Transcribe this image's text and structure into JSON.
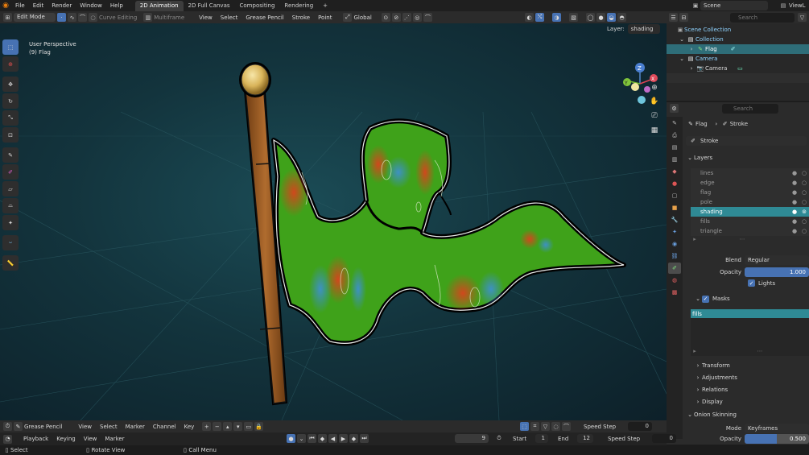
{
  "menu": {
    "items": [
      "File",
      "Edit",
      "Render",
      "Window",
      "Help"
    ],
    "workspaces": [
      {
        "label": "2D Animation",
        "active": true
      },
      {
        "label": "2D Full Canvas",
        "active": false
      },
      {
        "label": "Compositing",
        "active": false
      },
      {
        "label": "Rendering",
        "active": false
      }
    ],
    "add_tab": "+",
    "scene_label": "Scene",
    "view_layer_label": "ViewL"
  },
  "viewport_header": {
    "mode": "Edit Mode",
    "curve_editing": "Curve Editing",
    "multiframe": "Multiframe",
    "menus": [
      "View",
      "Select",
      "Grease Pencil",
      "Stroke",
      "Point"
    ],
    "transform_orientation": "Global",
    "layer_label": "Layer:",
    "layer_value": "shading"
  },
  "viewport": {
    "perspective_label": "User Perspective",
    "object_label": "(9) Flag",
    "gizmo": {
      "z": "Z",
      "x": "X",
      "y": "Y"
    },
    "colors": {
      "bg_center": "#1b4c56",
      "flag_green": "#3fa21a",
      "pole_brown": "#9a5a24",
      "knob_gold": "#d9b45a"
    }
  },
  "toolbar": {
    "tools": [
      "select-box",
      "cursor",
      "move",
      "rotate",
      "scale",
      "transform",
      "draw",
      "tint",
      "shear",
      "to-sphere",
      "radius",
      "interpolate",
      "measure"
    ]
  },
  "outliner": {
    "search_placeholder": "Search",
    "rows": [
      {
        "label": "Scene Collection",
        "indent": 0,
        "selected": false
      },
      {
        "label": "Collection",
        "indent": 1,
        "selected": false
      },
      {
        "label": "Flag",
        "indent": 2,
        "selected": true
      },
      {
        "label": "Camera",
        "indent": 1,
        "selected": false
      },
      {
        "label": "Camera",
        "indent": 2,
        "selected": false
      }
    ]
  },
  "properties": {
    "search_placeholder": "Search",
    "breadcrumb": {
      "object": "Flag",
      "data": "Stroke"
    },
    "data_name": "Stroke",
    "layers_title": "Layers",
    "layers": [
      {
        "name": "lines",
        "selected": false
      },
      {
        "name": "edge",
        "selected": false
      },
      {
        "name": "flag",
        "selected": false
      },
      {
        "name": "pole",
        "selected": false
      },
      {
        "name": "shading",
        "selected": true
      },
      {
        "name": "fills",
        "selected": false
      },
      {
        "name": "triangle",
        "selected": false
      }
    ],
    "blend_label": "Blend",
    "blend_value": "Regular",
    "opacity_label": "Opacity",
    "opacity_value": "1.000",
    "opacity_fraction": 1.0,
    "lights_label": "Lights",
    "masks_title": "Masks",
    "mask_item": "fills",
    "sections": [
      "Transform",
      "Adjustments",
      "Relations",
      "Display"
    ],
    "onion_title": "Onion Skinning",
    "onion_mode_label": "Mode",
    "onion_mode_value": "Keyframes",
    "onion_opacity_label": "Opacity",
    "onion_opacity_value": "0.500",
    "onion_opacity_fraction": 0.5
  },
  "timeline": {
    "editor": "Grease Pencil",
    "menus": [
      "View",
      "Select",
      "Marker",
      "Channel",
      "Key"
    ],
    "speed_step_label": "Speed Step",
    "speed_step_value": "0",
    "playback_menus": [
      "Playback",
      "Keying",
      "View",
      "Marker"
    ],
    "current_frame": "9",
    "start_label": "Start",
    "start_value": "1",
    "end_label": "End",
    "end_value": "12",
    "speed_step2_label": "Speed Step",
    "speed_step2_value": "0"
  },
  "status": {
    "select": "Select",
    "rotate_view": "Rotate View",
    "call_menu": "Call Menu"
  }
}
